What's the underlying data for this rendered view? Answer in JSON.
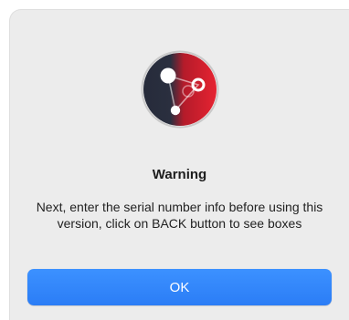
{
  "dialog": {
    "icon": "app-logo-icon",
    "title": "Warning",
    "message": "Next, enter the serial number info before using this version, click on BACK button to see boxes",
    "ok_label": "OK"
  },
  "colors": {
    "dialog_background": "#ececec",
    "accent": "#2f84fa",
    "icon_red": "#e2222f",
    "icon_dark": "#2a2f3f"
  }
}
